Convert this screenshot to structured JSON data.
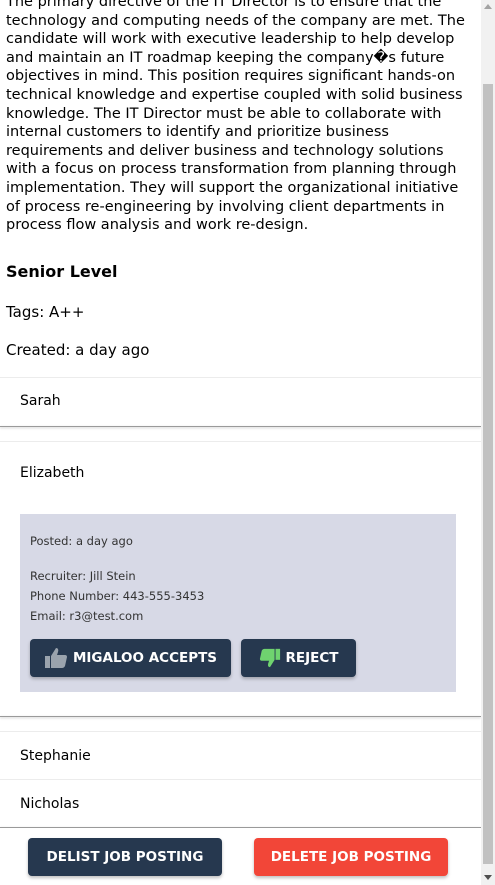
{
  "job": {
    "description": "The primary directive of the IT Director is to ensure that the technology and computing needs of the company are met. The candidate will work with executive leadership to help develop and maintain an IT roadmap keeping the company�s future objectives in mind. This position requires significant hands-on technical knowledge and expertise coupled with solid business knowledge. The IT Director must be able to collaborate with internal customers to identify and prioritize business requirements and deliver business and technology solutions with a focus on process transformation from planning through implementation. They will support the organizational initiative of process re-engineering by involving client departments in process flow analysis and work re-design.",
    "level": "Senior Level",
    "tags": "Tags: A++",
    "created": "Created: a day ago"
  },
  "candidates": [
    {
      "name": "Sarah"
    },
    {
      "name": "Elizabeth",
      "posted": "Posted: a day ago",
      "recruiter": "Recruiter: Jill Stein",
      "phone": "Phone Number: 443-555-3453",
      "email": "Email: r3@test.com",
      "accept_label": "MIGALOO ACCEPTS",
      "reject_label": "REJECT"
    },
    {
      "name": "Stephanie"
    },
    {
      "name": "Nicholas"
    }
  ],
  "footer": {
    "delist_label": "DELIST JOB POSTING",
    "delete_label": "DELETE JOB POSTING"
  },
  "colors": {
    "navy": "#26384f",
    "red": "#f24638",
    "panel": "#d7d9e6",
    "icon_green": "#6fd36f"
  }
}
